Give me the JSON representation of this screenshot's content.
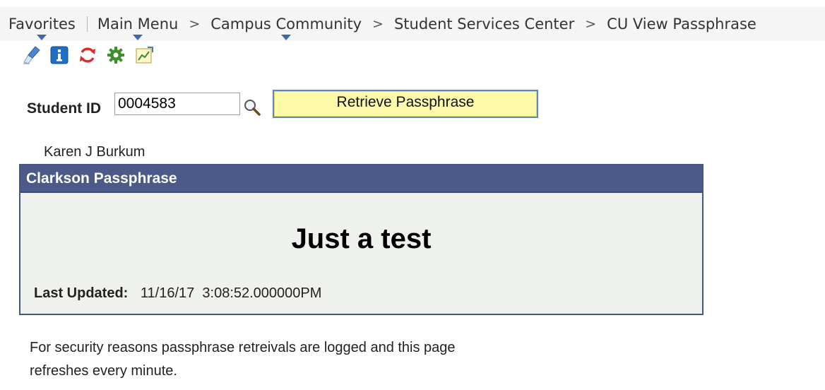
{
  "breadcrumb": {
    "items": [
      "Favorites",
      "Main Menu",
      "Campus Community",
      "Student Services Center",
      "CU View Passphrase"
    ],
    "separator": ">"
  },
  "toolbar": {
    "icons": [
      "clear-icon",
      "info-icon",
      "refresh-icon",
      "settings-icon",
      "report-icon"
    ]
  },
  "search": {
    "label": "Student ID",
    "value": "0004583",
    "button_label": "Retrieve Passphrase"
  },
  "student": {
    "name": "Karen J Burkum"
  },
  "passphrase_box": {
    "title": "Clarkson Passphrase",
    "passphrase": "Just a test",
    "last_updated_label": "Last Updated:",
    "last_updated_value": "11/16/17  3:08:52.000000PM"
  },
  "notice": {
    "line1": "For security reasons passphrase retreivals are logged and this page",
    "line2": "refreshes every minute."
  },
  "colors": {
    "header_bg": "#4b5a88",
    "box_bg": "#eff1ed",
    "button_bg": "#fffaa9",
    "button_border": "#5c86c4",
    "caret": "#3d6aaf"
  }
}
